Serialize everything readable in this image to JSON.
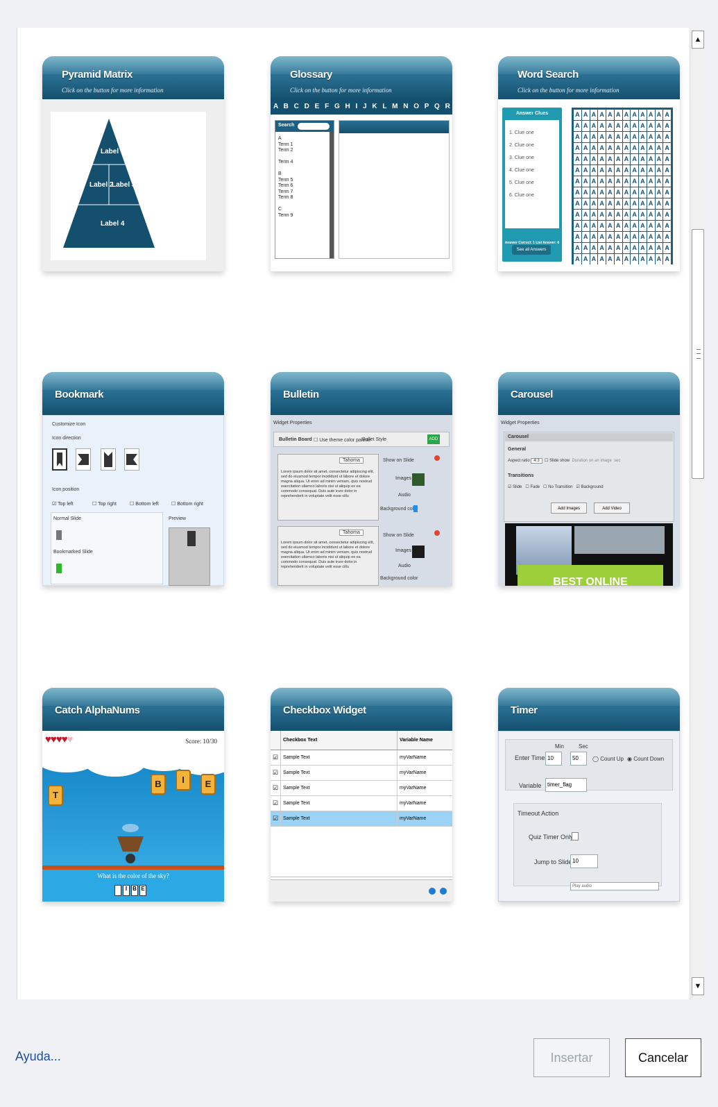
{
  "cards": [
    {
      "title": "Pyramid Matrix",
      "subtitle": "Click on the button for more information"
    },
    {
      "title": "Glossary",
      "subtitle": "Click on the button for more information"
    },
    {
      "title": "Word Search",
      "subtitle": "Click on the button for more information"
    },
    {
      "title": "Bookmark"
    },
    {
      "title": "Bulletin"
    },
    {
      "title": "Carousel"
    },
    {
      "title": "Catch AlphaNums"
    },
    {
      "title": "Checkbox Widget"
    },
    {
      "title": "Timer"
    }
  ],
  "pyramid": {
    "labels": [
      "Label 1",
      "Label 2",
      "Label 3",
      "Label 4"
    ]
  },
  "glossary": {
    "alphabet": "A B C D E F G H I J K L M N O P Q R S T U V W X Y Z",
    "search_label": "Search",
    "terms": [
      "A",
      "Term 1",
      "Term 2",
      "",
      "Term 4",
      "",
      "B",
      "Term 5",
      "Term 6",
      "Term 7",
      "Term 8",
      "",
      "C",
      "Term 9"
    ]
  },
  "word_search": {
    "header": "Answer Clues",
    "clues": [
      "1. Clue one",
      "2. Clue one",
      "3. Clue one",
      "4. Clue one",
      "5. Clue one",
      "6. Clue one"
    ],
    "footer_status": "Answer Correct: 1   List Answer: 6",
    "button": "See all Answers",
    "letter": "A"
  },
  "bookmark": {
    "customize": "Customize Icon",
    "direction": "Icon direction",
    "position": "Icon position",
    "positions": [
      "Top left",
      "Top right",
      "Bottom left",
      "Bottom right"
    ],
    "normal": "Normal Slide",
    "bookmarked": "Bookmarked Slide",
    "preview": "Preview"
  },
  "bulletin": {
    "props": "Widget Properties",
    "board": "Bulletin Board",
    "theme": "Use theme color palette",
    "style": "Bullet Style",
    "add": "ADD",
    "font": "Tahoma",
    "lorem": "Lorem ipsum dolor sit amet, consectetur adipiscing elit, sed do eiusmod tempor incididunt ut labore et dolore magna aliqua. Ut enim ad minim veniam, quis nostrud exercitation ullamco laboris nisi ut aliquip ex ea commodo consequat. Duis aute irure dolor in reprehenderit in voluptate velit esse cillu",
    "show": "Show on Slide",
    "images": "Images",
    "audio": "Audio",
    "bg": "Background color"
  },
  "carousel": {
    "props": "Widget Properties",
    "tab": "Carousel",
    "general": "General",
    "transitions": "Transitions",
    "opts": [
      "Slide",
      "Fade",
      "No Transition",
      "Background"
    ],
    "add_images": "Add Images",
    "add_video": "Add Video",
    "aspect": "Aspect ratio",
    "aspect_val": "4:3",
    "slideshow": "Slide show",
    "duration": "Duration on an image",
    "sec": "sec",
    "banner": "BEST ONLINE"
  },
  "catch": {
    "score": "Score: 10/30",
    "question": "What is the color of the sky?",
    "tiles": [
      "T",
      "B",
      "I",
      "E"
    ],
    "answer": [
      "",
      "I",
      "B",
      "E"
    ]
  },
  "checkbox": {
    "col1": "Checkbox Text",
    "col2": "Variable Name",
    "rows": [
      {
        "text": "Sample Text",
        "var": "myVarName"
      },
      {
        "text": "Sample Text",
        "var": "myVarName"
      },
      {
        "text": "Sample Text",
        "var": "myVarName"
      },
      {
        "text": "Sample Text",
        "var": "myVarName"
      },
      {
        "text": "Sample Text",
        "var": "myVarName"
      }
    ]
  },
  "timer": {
    "min": "Min",
    "sec": "Sec",
    "enter_time": "Enter Time",
    "min_val": "10",
    "sec_val": "50",
    "count_up": "Count Up",
    "count_down": "Count Down",
    "variable": "Variable",
    "variable_val": "timer_flag",
    "timeout": "Timeout Action",
    "quiz_only": "Quiz Timer Only",
    "jump": "Jump to Slide",
    "jump_val": "10",
    "partial": "Play audio"
  },
  "footer": {
    "help": "Ayuda...",
    "insert": "Insertar",
    "cancel": "Cancelar"
  },
  "colors": {
    "header_dark": "#14506e",
    "header_light": "#3b8fb0",
    "link": "#1f4f9c"
  }
}
